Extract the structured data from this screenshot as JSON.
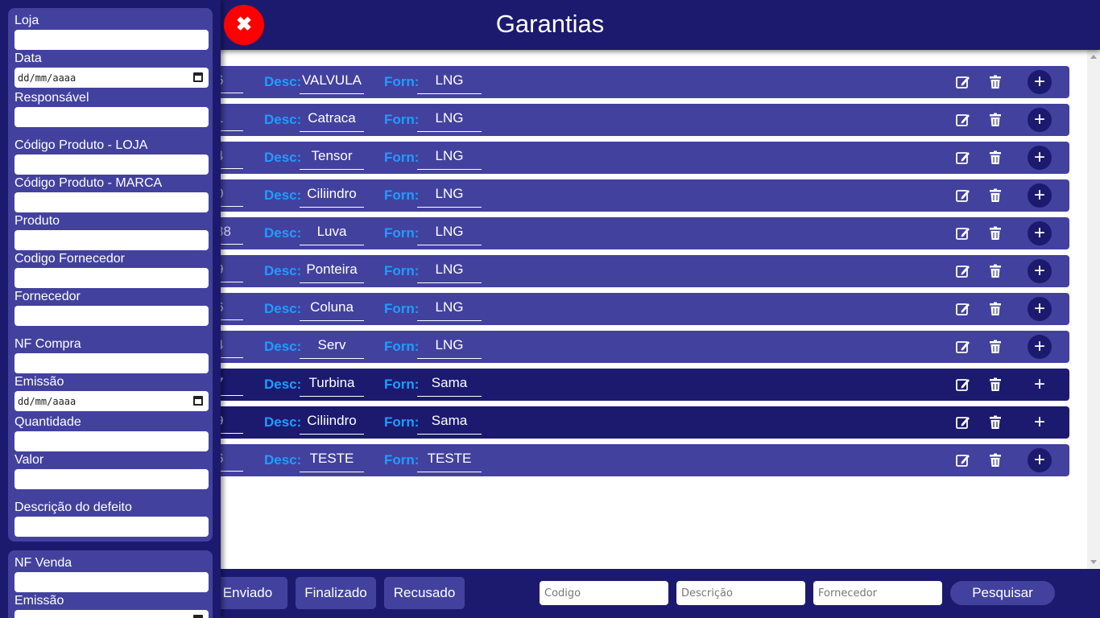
{
  "header": {
    "title": "Garantias",
    "close_label": "✖"
  },
  "rows": [
    {
      "code": "6",
      "desc_label": "Desc:",
      "desc": "VALVULA",
      "forn_label": "Forn:",
      "forn": "LNG",
      "dark": false
    },
    {
      "code": "1",
      "desc_label": "Desc:",
      "desc": "Catraca",
      "forn_label": "Forn:",
      "forn": "LNG",
      "dark": false
    },
    {
      "code": "4",
      "desc_label": "Desc:",
      "desc": "Tensor",
      "forn_label": "Forn:",
      "forn": "LNG",
      "dark": false
    },
    {
      "code": "0",
      "desc_label": "Desc:",
      "desc": "Ciliindro",
      "forn_label": "Forn:",
      "forn": "LNG",
      "dark": false
    },
    {
      "code": "38",
      "desc_label": "Desc:",
      "desc": "Luva",
      "forn_label": "Forn:",
      "forn": "LNG",
      "dark": false
    },
    {
      "code": "9",
      "desc_label": "Desc:",
      "desc": "Ponteira",
      "forn_label": "Forn:",
      "forn": "LNG",
      "dark": false
    },
    {
      "code": "6",
      "desc_label": "Desc:",
      "desc": "Coluna",
      "forn_label": "Forn:",
      "forn": "LNG",
      "dark": false
    },
    {
      "code": "4",
      "desc_label": "Desc:",
      "desc": "Serv",
      "forn_label": "Forn:",
      "forn": "LNG",
      "dark": false
    },
    {
      "code": "7",
      "desc_label": "Desc:",
      "desc": "Turbina",
      "forn_label": "Forn:",
      "forn": "Sama",
      "dark": true
    },
    {
      "code": "9",
      "desc_label": "Desc:",
      "desc": "Ciliindro",
      "forn_label": "Forn:",
      "forn": "Sama",
      "dark": true
    },
    {
      "code": "6",
      "desc_label": "Desc:",
      "desc": "TESTE",
      "forn_label": "Forn:",
      "forn": "TESTE",
      "dark": false
    }
  ],
  "row_icons": {
    "edit": "edit-icon",
    "delete": "trash-icon",
    "add": "+"
  },
  "footer": {
    "buttons": [
      "Enviado",
      "Finalizado",
      "Recusado"
    ],
    "search": {
      "codigo_placeholder": "Codigo",
      "descricao_placeholder": "Descrição",
      "fornecedor_placeholder": "Fornecedor",
      "button_label": "Pesquisar"
    }
  },
  "form": {
    "loja": "Loja",
    "data": "Data",
    "date_placeholder": "dd/mm/aaaa",
    "responsavel": "Responsável",
    "codigo_loja": "Código Produto - LOJA",
    "codigo_marca": "Código Produto - MARCA",
    "produto": "Produto",
    "codigo_fornecedor": "Codigo Fornecedor",
    "fornecedor": "Fornecedor",
    "nf_compra": "NF Compra",
    "emissao": "Emissão",
    "quantidade": "Quantidade",
    "valor": "Valor",
    "descricao_defeito": "Descrição do defeito",
    "nf_venda": "NF Venda",
    "emissao2": "Emissão"
  },
  "colors": {
    "dark_navy": "#1c1a6e",
    "row_blue": "#43419e",
    "label_blue": "#1e9dff",
    "close_red": "#ff0000"
  }
}
